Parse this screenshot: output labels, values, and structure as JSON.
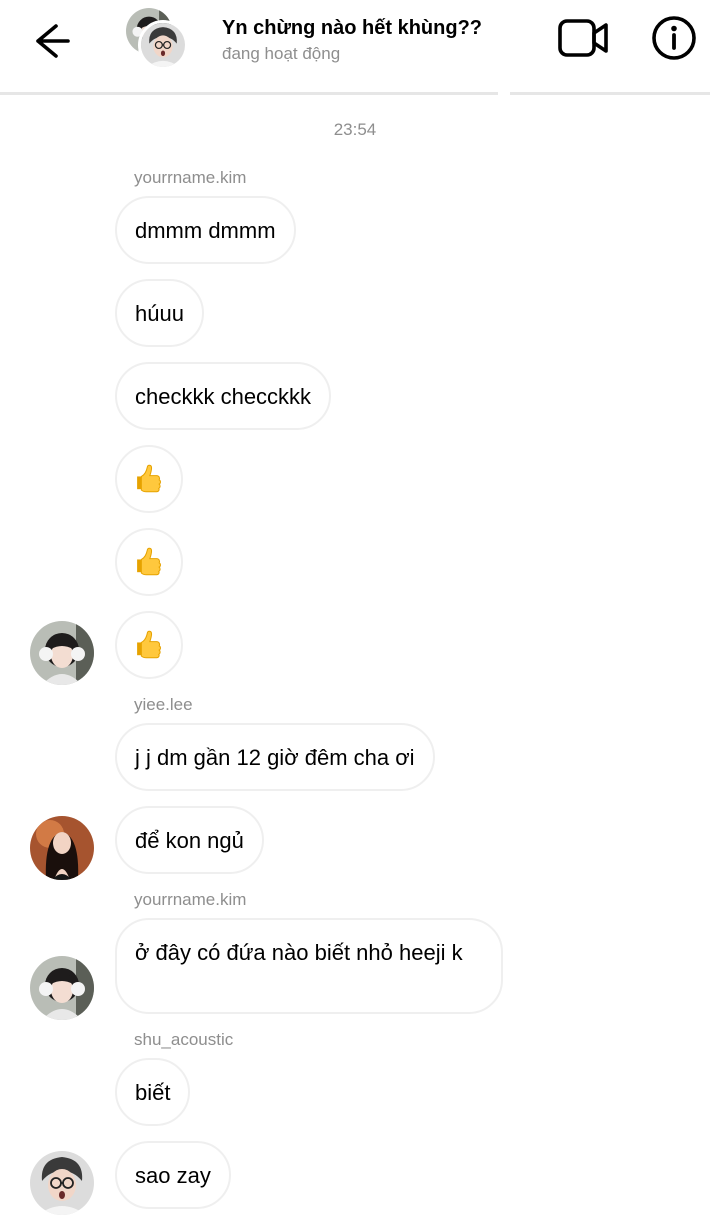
{
  "header": {
    "title": "Yn chừng nào hết khùng??",
    "status": "đang hoạt động"
  },
  "icons": {
    "back": "arrow-left-icon",
    "video": "video-camera-icon",
    "info": "info-circle-icon",
    "thumbs_up": "thumbs-up-emoji"
  },
  "messages": {
    "timestamp": "23:54",
    "sender_1": "yourrname.kim",
    "m1": "dmmm dmmm",
    "m2": "húuu",
    "m3": "checkkk checckkk",
    "sender_2": "yiee.lee",
    "m4": "j j dm gần 12 giờ đêm cha ơi",
    "m5": "để kon ngủ",
    "sender_3": "yourrname.kim",
    "m6": "ở đây có đứa nào biết nhỏ heeji k",
    "sender_4": "shu_acoustic",
    "m7": "biết",
    "m8": "sao zay"
  },
  "colors": {
    "bubble_border": "#efefef",
    "secondary_text": "#8e8e8e",
    "divider": "#e6e6e6"
  }
}
